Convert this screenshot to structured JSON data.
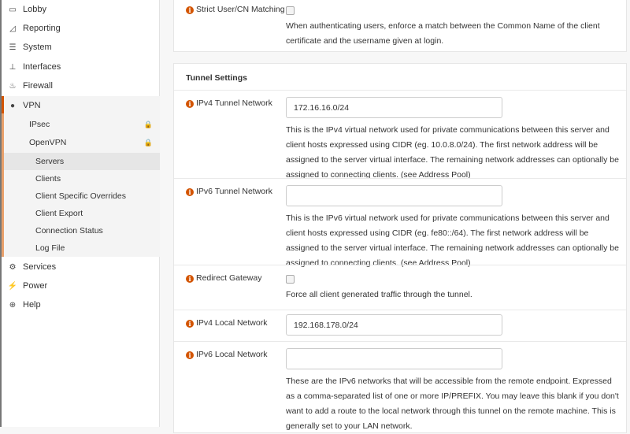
{
  "sidebar": {
    "items": [
      {
        "label": "Lobby",
        "icon": "laptop-icon"
      },
      {
        "label": "Reporting",
        "icon": "area-chart-icon"
      },
      {
        "label": "System",
        "icon": "server-icon"
      },
      {
        "label": "Interfaces",
        "icon": "sitemap-icon"
      },
      {
        "label": "Firewall",
        "icon": "fire-icon"
      },
      {
        "label": "VPN",
        "icon": "globe-icon"
      },
      {
        "label": "Services",
        "icon": "cog-icon"
      },
      {
        "label": "Power",
        "icon": "plug-icon"
      },
      {
        "label": "Help",
        "icon": "lifebuoy-icon"
      }
    ],
    "vpn_sub": [
      {
        "label": "IPsec"
      },
      {
        "label": "OpenVPN"
      }
    ],
    "openvpn_sub": [
      "Servers",
      "Clients",
      "Client Specific Overrides",
      "Client Export",
      "Connection Status",
      "Log File"
    ]
  },
  "strict": {
    "label": "Strict User/CN Matching",
    "desc": "When authenticating users, enforce a match between the Common Name of the client certificate and the username given at login."
  },
  "tunnel": {
    "title": "Tunnel Settings",
    "ipv4_tunnel": {
      "label": "IPv4 Tunnel Network",
      "value": "172.16.16.0/24",
      "desc": "This is the IPv4 virtual network used for private communications between this server and client hosts expressed using CIDR (eg. 10.0.8.0/24). The first network address will be assigned to the server virtual interface. The remaining network addresses can optionally be assigned to connecting clients. (see Address Pool)"
    },
    "ipv6_tunnel": {
      "label": "IPv6 Tunnel Network",
      "value": "",
      "desc": "This is the IPv6 virtual network used for private communications between this server and client hosts expressed using CIDR (eg. fe80::/64). The first network address will be assigned to the server virtual interface. The remaining network addresses can optionally be assigned to connecting clients. (see Address Pool)"
    },
    "redirect": {
      "label": "Redirect Gateway",
      "desc": "Force all client generated traffic through the tunnel."
    },
    "ipv4_local": {
      "label": "IPv4 Local Network",
      "value": "192.168.178.0/24"
    },
    "ipv6_local": {
      "label": "IPv6 Local Network",
      "value": "",
      "desc": "These are the IPv6 networks that will be accessible from the remote endpoint. Expressed as a comma-separated list of one or more IP/PREFIX. You may leave this blank if you don't want to add a route to the local network through this tunnel on the remote machine. This is generally set to your LAN network."
    }
  },
  "colors": {
    "accent": "#d35400"
  }
}
